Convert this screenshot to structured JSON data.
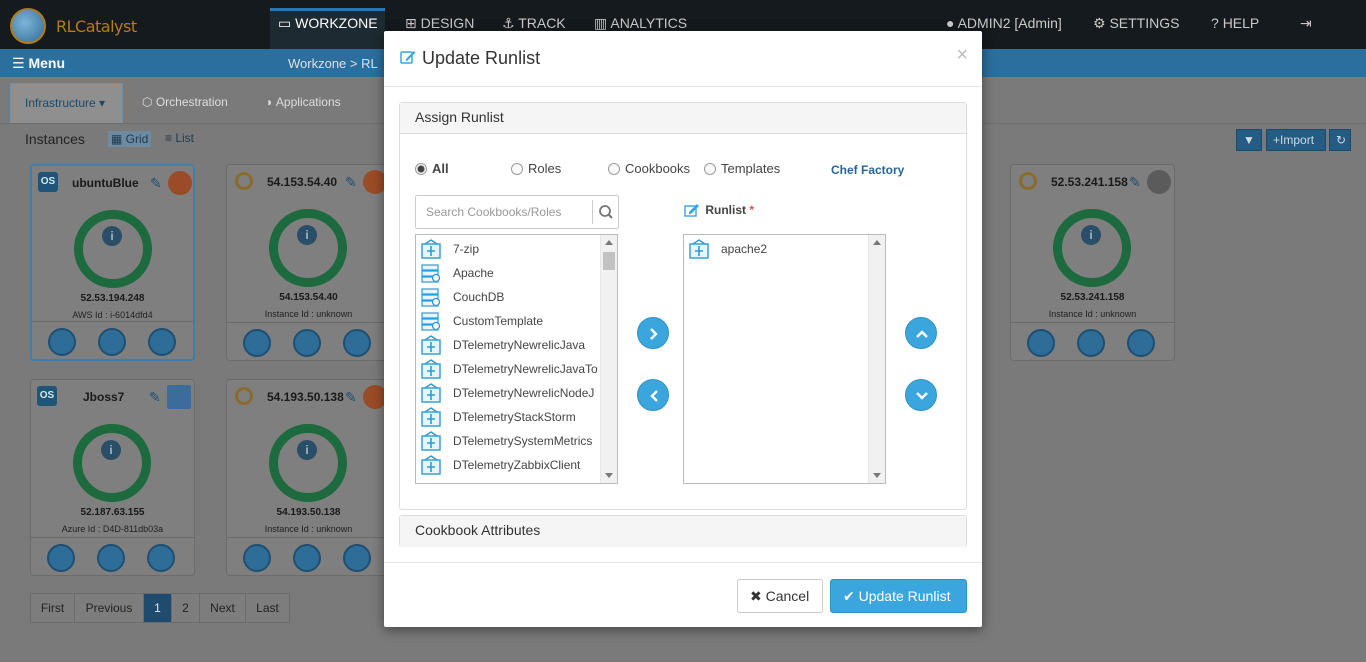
{
  "app": {
    "logo_text": "RLCatalyst",
    "nav": [
      {
        "label": "WORKZONE",
        "icon": "monitor-icon"
      },
      {
        "label": "DESIGN",
        "icon": "sitemap-icon"
      },
      {
        "label": "TRACK",
        "icon": "anchor-icon"
      },
      {
        "label": "ANALYTICS",
        "icon": "bar-chart-icon"
      }
    ],
    "user": "ADMIN2 [Admin]",
    "settings": "SETTINGS",
    "help": "HELP",
    "menu_label": "Menu",
    "breadcrumb": "Workzone > RL",
    "tabs": [
      "Infrastructure",
      "Orchestration",
      "Applications"
    ],
    "instances_label": "Instances",
    "view_grid": "Grid",
    "view_list": "List",
    "import_label": "Import"
  },
  "cards": [
    {
      "title": "ubuntuBlue",
      "ip": "52.53.194.248",
      "id_line": "AWS Id : i-6014dfd4",
      "os": "OS"
    },
    {
      "title": "54.153.54.40",
      "ip": "54.153.54.40",
      "id_line": "Instance Id : unknown"
    },
    {
      "title": "52.53.241.158",
      "ip": "52.53.241.158",
      "id_line": "Instance Id : unknown"
    },
    {
      "title": "Jboss7",
      "ip": "52.187.63.155",
      "id_line": "Azure Id : D4D-811db03a",
      "os": "OS"
    },
    {
      "title": "54.193.50.138",
      "ip": "54.193.50.138",
      "id_line": "Instance Id : unknown"
    }
  ],
  "pager": [
    "First",
    "Previous",
    "1",
    "2",
    "Next",
    "Last"
  ],
  "modal": {
    "title": "Update Runlist",
    "close": "×",
    "assign_panel_title": "Assign Runlist",
    "filters": [
      "All",
      "Roles",
      "Cookbooks",
      "Templates"
    ],
    "selected_filter": "All",
    "chef_factory": "Chef Factory",
    "search_placeholder": "Search Cookbooks/Roles",
    "runlist_label": "Runlist",
    "runlist_required": "*",
    "available_items": [
      {
        "label": "7-zip",
        "type": "cookbook"
      },
      {
        "label": "Apache",
        "type": "template"
      },
      {
        "label": "CouchDB",
        "type": "template"
      },
      {
        "label": "CustomTemplate",
        "type": "template"
      },
      {
        "label": "DTelemetryNewrelicJava",
        "type": "cookbook"
      },
      {
        "label": "DTelemetryNewrelicJavaTo",
        "type": "cookbook"
      },
      {
        "label": "DTelemetryNewrelicNodeJ",
        "type": "cookbook"
      },
      {
        "label": "DTelemetryStackStorm",
        "type": "cookbook"
      },
      {
        "label": "DTelemetrySystemMetrics",
        "type": "cookbook"
      },
      {
        "label": "DTelemetryZabbixClient",
        "type": "cookbook"
      }
    ],
    "runlist_items": [
      {
        "label": "apache2",
        "type": "cookbook"
      }
    ],
    "attributes_panel_title": "Cookbook Attributes",
    "cancel_label": "Cancel",
    "update_label": "Update Runlist"
  },
  "colors": {
    "accent": "#3ba6dd",
    "topbar": "#141a1d",
    "menubar": "#2a6f9e",
    "link": "#2a6496"
  }
}
